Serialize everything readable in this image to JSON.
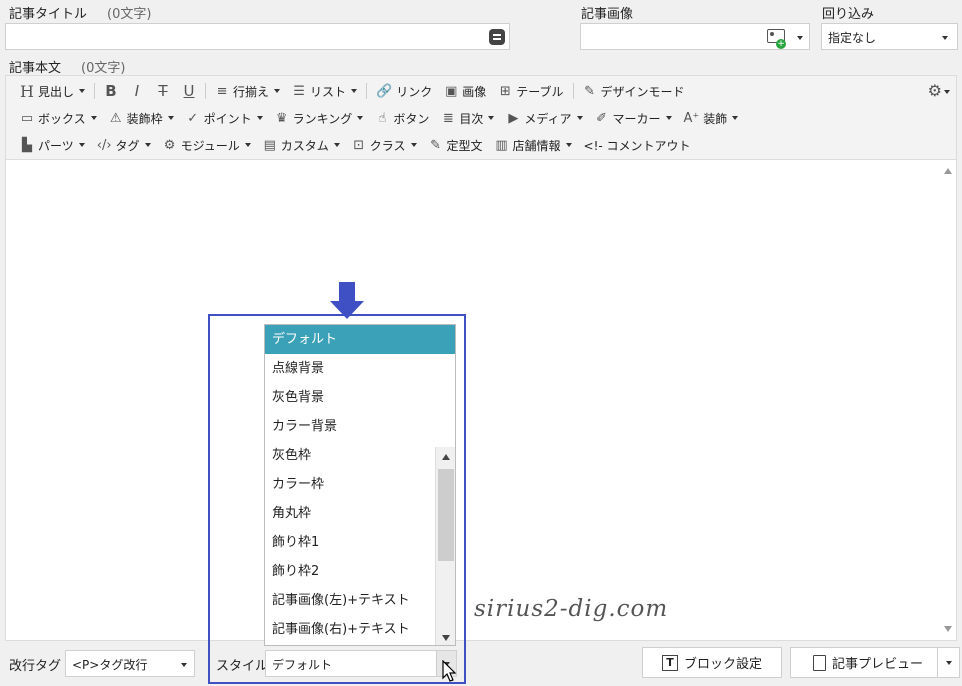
{
  "title_field": {
    "label": "記事タイトル",
    "count": "(0文字)"
  },
  "image_field": {
    "label": "記事画像"
  },
  "wrap_field": {
    "label": "回り込み",
    "value": "指定なし"
  },
  "body_field": {
    "label": "記事本文",
    "count": "(0文字)"
  },
  "toolbar": {
    "row1": [
      {
        "icon": "H",
        "label": "見出し",
        "dd": true
      },
      {
        "icon": "B",
        "label": "",
        "dd": false
      },
      {
        "icon": "I",
        "label": "",
        "dd": false
      },
      {
        "icon": "T",
        "label": "",
        "dd": false
      },
      {
        "icon": "U",
        "label": "",
        "dd": false
      },
      {
        "icon": "≡",
        "label": "行揃え",
        "dd": true
      },
      {
        "icon": "☰",
        "label": "リスト",
        "dd": true
      },
      {
        "icon": "🔗",
        "label": "リンク",
        "dd": false
      },
      {
        "icon": "▣",
        "label": "画像",
        "dd": false
      },
      {
        "icon": "⊞",
        "label": "テーブル",
        "dd": false
      },
      {
        "icon": "✎",
        "label": "デザインモード",
        "dd": false
      }
    ],
    "row2": [
      {
        "icon": "▭",
        "label": "ボックス",
        "dd": true
      },
      {
        "icon": "⚠",
        "label": "装飾枠",
        "dd": true
      },
      {
        "icon": "✓",
        "label": "ポイント",
        "dd": true
      },
      {
        "icon": "♛",
        "label": "ランキング",
        "dd": true
      },
      {
        "icon": "☝",
        "label": "ボタン",
        "dd": false
      },
      {
        "icon": "≣",
        "label": "目次",
        "dd": true
      },
      {
        "icon": "▶",
        "label": "メディア",
        "dd": true
      },
      {
        "icon": "✐",
        "label": "マーカー",
        "dd": true
      },
      {
        "icon": "A⁺",
        "label": "装飾",
        "dd": true
      }
    ],
    "row3": [
      {
        "icon": "▙",
        "label": "パーツ",
        "dd": true
      },
      {
        "icon": "‹/›",
        "label": "タグ",
        "dd": true
      },
      {
        "icon": "⚙",
        "label": "モジュール",
        "dd": true
      },
      {
        "icon": "▤",
        "label": "カスタム",
        "dd": true
      },
      {
        "icon": "⊡",
        "label": "クラス",
        "dd": true
      },
      {
        "icon": "✎",
        "label": "定型文",
        "dd": false
      },
      {
        "icon": "▥",
        "label": "店舗情報",
        "dd": true
      },
      {
        "icon": "",
        "label": "<!- コメントアウト",
        "dd": false
      }
    ]
  },
  "style_dropdown": {
    "options": [
      "デフォルト",
      "点線背景",
      "灰色背景",
      "カラー背景",
      "灰色枠",
      "カラー枠",
      "角丸枠",
      "飾り枠1",
      "飾り枠2",
      "記事画像(左)+テキスト",
      "記事画像(右)+テキスト"
    ],
    "selected_index": 0
  },
  "bottom": {
    "linebreak_label": "改行タグ",
    "linebreak_value": "<P>タグ改行",
    "style_label": "スタイル",
    "style_value": "デフォルト",
    "block_settings": "ブロック設定",
    "preview": "記事プレビュー"
  },
  "watermark": "sirius2-dig.com",
  "colors": {
    "accent": "#3ba1b8",
    "highlight_frame": "#3f4fc4"
  }
}
